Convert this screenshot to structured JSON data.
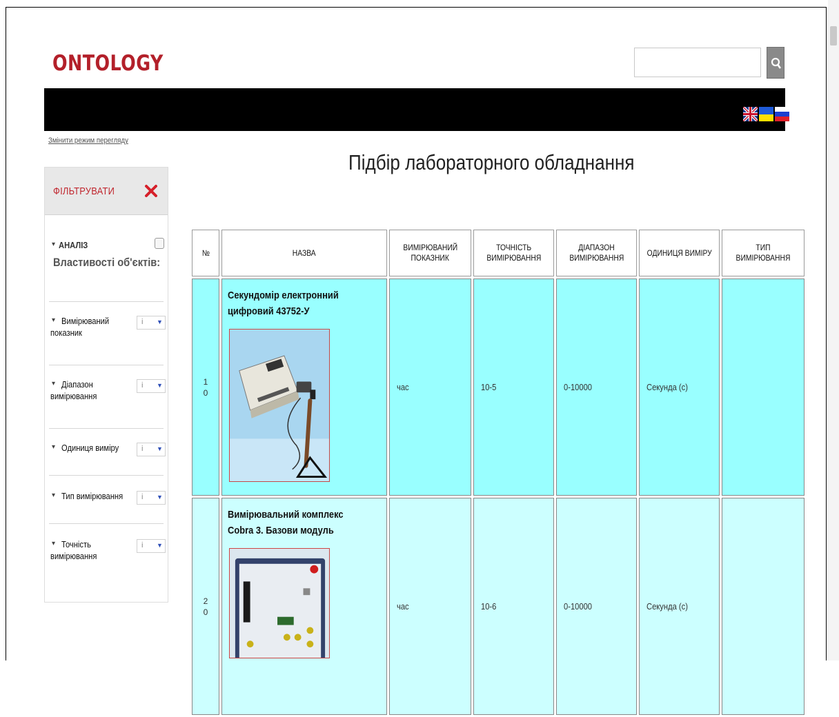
{
  "site": {
    "logo": "ONTOLOGY"
  },
  "search": {
    "placeholder": ""
  },
  "languages": [
    "en-flag-icon",
    "ua-flag-icon",
    "ru-flag-icon"
  ],
  "view_mode_link": "Змінити режим перегляду",
  "page_title": "Підбір лабораторного обладнання",
  "sidebar": {
    "filter_label": "ФІЛЬТРУВАТИ",
    "analysis_label": "АНАЛІЗ",
    "properties_title": "Властивості об'єктів:",
    "facets": [
      {
        "line1": "Вимірюваний",
        "line2": "показник",
        "value": "i"
      },
      {
        "line1": "Діапазон",
        "line2": "вимірювання",
        "value": "i"
      },
      {
        "line1": "Одиниця виміру",
        "line2": "",
        "value": "i"
      },
      {
        "line1": "Тип вимірювання",
        "line2": "",
        "value": "i"
      },
      {
        "line1": "Точність",
        "line2": "вимірювання",
        "value": "i"
      }
    ]
  },
  "table": {
    "headers": [
      {
        "line1": "№",
        "line2": ""
      },
      {
        "line1": "НАЗВА",
        "line2": ""
      },
      {
        "line1": "ВИМІРЮВАНИЙ",
        "line2": "ПОКАЗНИК"
      },
      {
        "line1": "ТОЧНІСТЬ",
        "line2": "ВИМІРЮВАННЯ"
      },
      {
        "line1": "ДІАПАЗОН",
        "line2": "ВИМІРЮВАННЯ"
      },
      {
        "line1": "ОДИНИЦЯ ВИМІРУ",
        "line2": ""
      },
      {
        "line1": "ТИП ВИМІРЮВАННЯ",
        "line2": ""
      }
    ],
    "rows": [
      {
        "num_a": "1",
        "num_b": "0",
        "name_1": "Секундомір електронний",
        "name_2": "цифровий 43752-У",
        "indicator": "час",
        "accuracy": "10-5",
        "range": "0-10000",
        "unit": "Секунда (с)",
        "type": ""
      },
      {
        "num_a": "2",
        "num_b": "0",
        "name_1": "Вимірювальний комплекс",
        "name_2": "Cobra 3. Базови модуль",
        "indicator": "час",
        "accuracy": "10-6",
        "range": "0-10000",
        "unit": "Секунда (с)",
        "type": ""
      }
    ]
  },
  "colors": {
    "logo": "#b3202a",
    "row_1": "#99ffff",
    "row_2": "#ccffff",
    "filter": "#c0262e"
  }
}
